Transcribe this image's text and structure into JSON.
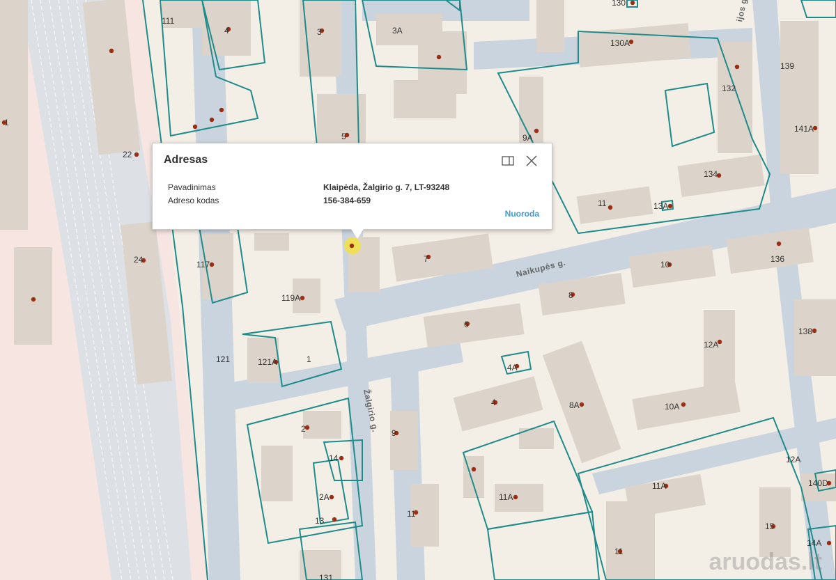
{
  "popup": {
    "title": "Adresas",
    "rows": [
      {
        "label": "Pavadinimas",
        "value": "Klaipėda, Žalgirio g. 7, LT-93248"
      },
      {
        "label": "Adreso kodas",
        "value": "156-384-659"
      }
    ],
    "link_label": "Nuoroda",
    "dock_icon": "dock-panel-icon",
    "close_icon": "close-icon"
  },
  "streets": {
    "naikupes": "Naikupės g.",
    "zalgirio": "Žalgirio g.",
    "partial": "ijos g."
  },
  "labels": [
    "111",
    "4",
    "3",
    "3A",
    "130",
    "130A",
    "132",
    "139",
    "141A",
    "9A",
    "5",
    "22",
    "134",
    "11",
    "13A",
    "24",
    "117",
    "7",
    "119A",
    "10",
    "136",
    "8",
    "6",
    "138",
    "12A",
    "121",
    "121A",
    "1",
    "4A",
    "4",
    "8A",
    "10A",
    "2",
    "9",
    "12A",
    "140D",
    "14",
    "2A",
    "11",
    "11A",
    "11A",
    "13",
    "11",
    "14A",
    "15",
    "131",
    "1"
  ],
  "watermark": "aruodas.lt",
  "colors": {
    "background": "#f4efe6",
    "road": "#c9d4df",
    "building": "#dcd4ca",
    "parcel": "#1e8b8b",
    "railway_zone": "#f6e5e1",
    "address_point": "#9b2d13",
    "selected": "#f1e04a",
    "link": "#3e9ad6"
  }
}
